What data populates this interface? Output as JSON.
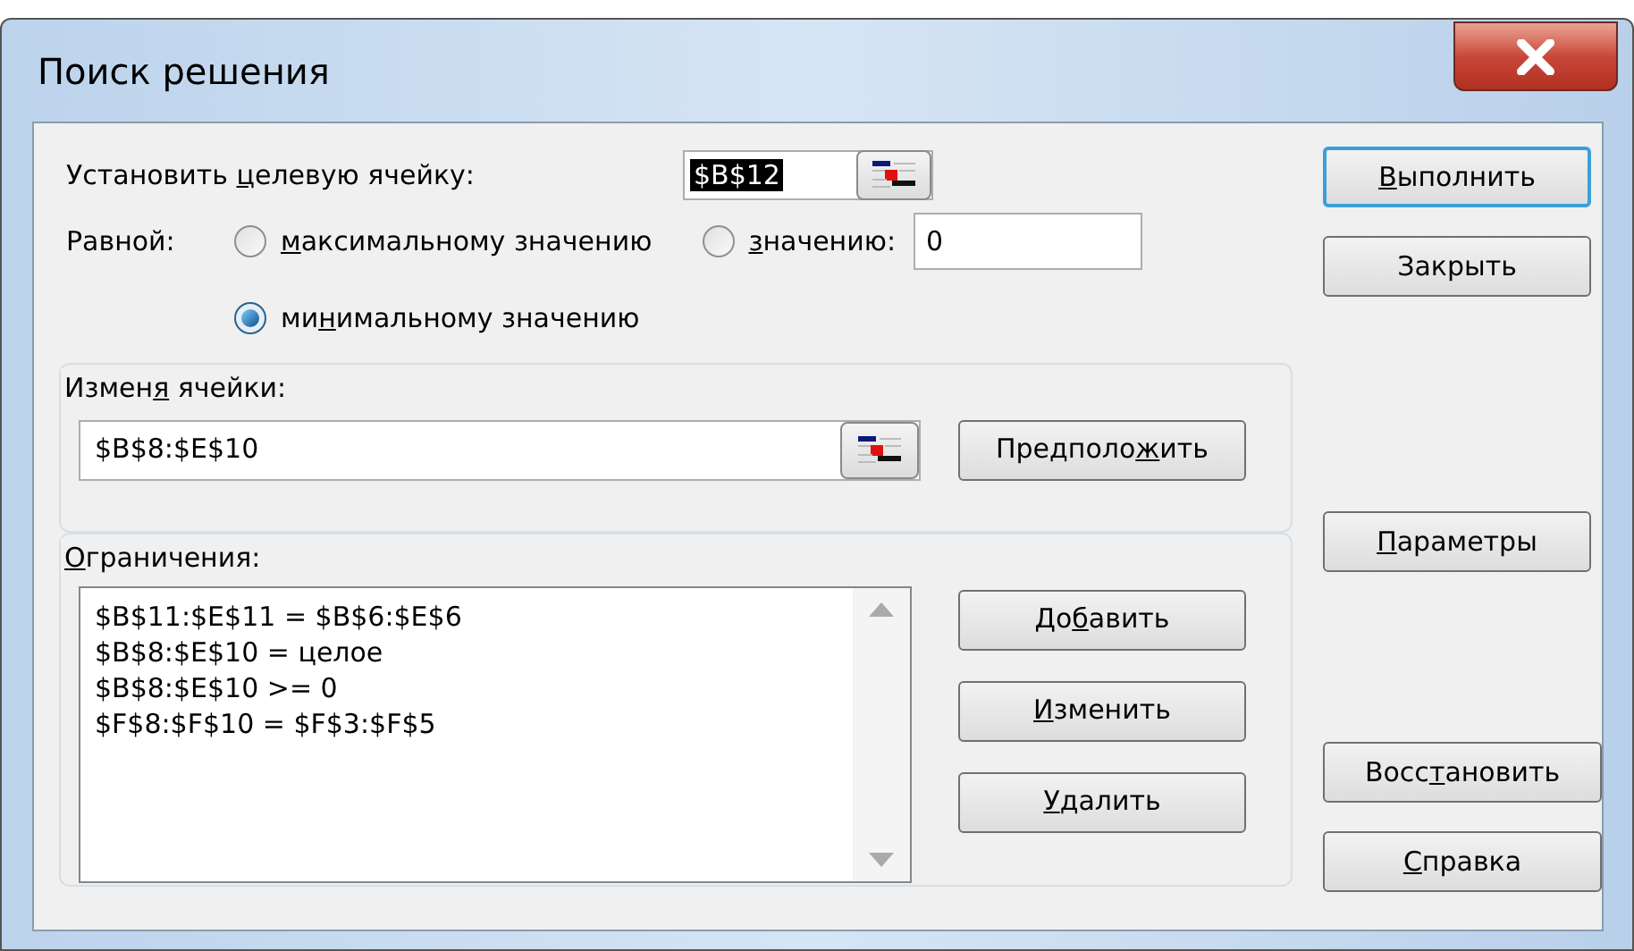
{
  "window": {
    "title": "Поиск решения"
  },
  "target": {
    "label": {
      "pre": "Установить ",
      "key": "ц",
      "post": "елевую ячейку:"
    },
    "value": "$B$12",
    "selected": true
  },
  "equal_to": {
    "label": {
      "text": "Равной:"
    },
    "options": [
      {
        "kind": "max",
        "label": {
          "key": "м",
          "post": "аксимальному значению"
        },
        "selected": false
      },
      {
        "kind": "value",
        "label": {
          "key": "з",
          "post": "начению:"
        },
        "selected": false,
        "value": "0"
      },
      {
        "kind": "min",
        "label": {
          "pre": "ми",
          "key": "н",
          "post": "имальному значению"
        },
        "selected": true
      }
    ]
  },
  "changing_cells": {
    "label": {
      "pre": "Измен",
      "key": "я",
      "post": " ячейки:"
    },
    "value": "$B$8:$E$10",
    "button": {
      "pre": "Предполо",
      "key": "ж",
      "post": "ить"
    }
  },
  "constraints": {
    "label": {
      "key": "О",
      "post": "граничения:"
    },
    "items": [
      "$B$11:$E$11 = $B$6:$E$6",
      "$B$8:$E$10 = целое",
      "$B$8:$E$10 >= 0",
      "$F$8:$F$10 = $F$3:$F$5"
    ],
    "buttons": [
      {
        "pre": "До",
        "key": "б",
        "post": "авить"
      },
      {
        "key": "И",
        "post": "зменить"
      },
      {
        "key": "У",
        "post": "далить"
      }
    ]
  },
  "side_buttons": [
    {
      "kind": "top",
      "label": {
        "key": "В",
        "post": "ыполнить"
      },
      "focused": true
    },
    {
      "kind": "top",
      "label": {
        "text": "Закрыть"
      },
      "focused": false
    },
    {
      "kind": "middle",
      "label": {
        "key": "П",
        "post": "араметры"
      },
      "focused": false
    },
    {
      "kind": "bottom",
      "label": {
        "pre": "Восс",
        "key": "т",
        "post": "ановить"
      },
      "focused": false
    },
    {
      "kind": "bottom",
      "label": {
        "key": "С",
        "post": "правка"
      },
      "focused": false
    }
  ]
}
